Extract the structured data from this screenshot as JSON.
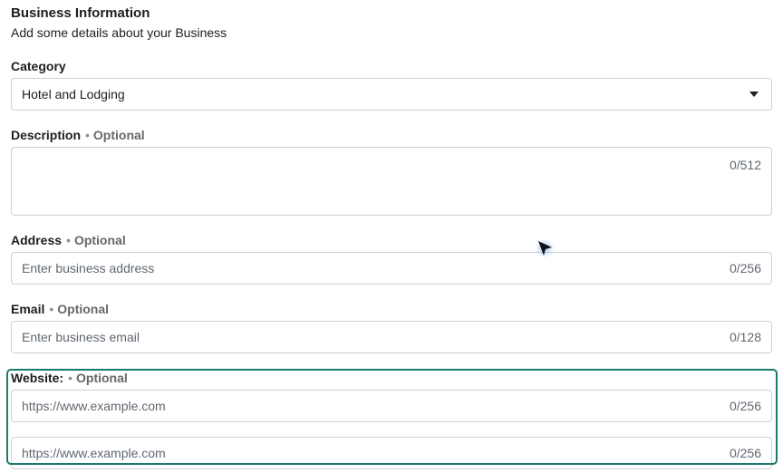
{
  "section": {
    "title": "Business Information",
    "subtitle": "Add some details about your Business"
  },
  "optional_label": "Optional",
  "category": {
    "label": "Category",
    "value": "Hotel and Lodging"
  },
  "description": {
    "label": "Description",
    "value": "",
    "counter": "0/512"
  },
  "address": {
    "label": "Address",
    "placeholder": "Enter business address",
    "counter": "0/256"
  },
  "email": {
    "label": "Email",
    "placeholder": "Enter business email",
    "counter": "0/128"
  },
  "website": {
    "label": "Website:",
    "fields": [
      {
        "placeholder": "https://www.example.com",
        "counter": "0/256"
      },
      {
        "placeholder": "https://www.example.com",
        "counter": "0/256"
      }
    ]
  },
  "colors": {
    "highlight": "#1a7a6c",
    "border": "#ccd0d5"
  },
  "icons": {
    "dropdown": "caret-down-icon",
    "cursor": "mouse-pointer-icon"
  }
}
